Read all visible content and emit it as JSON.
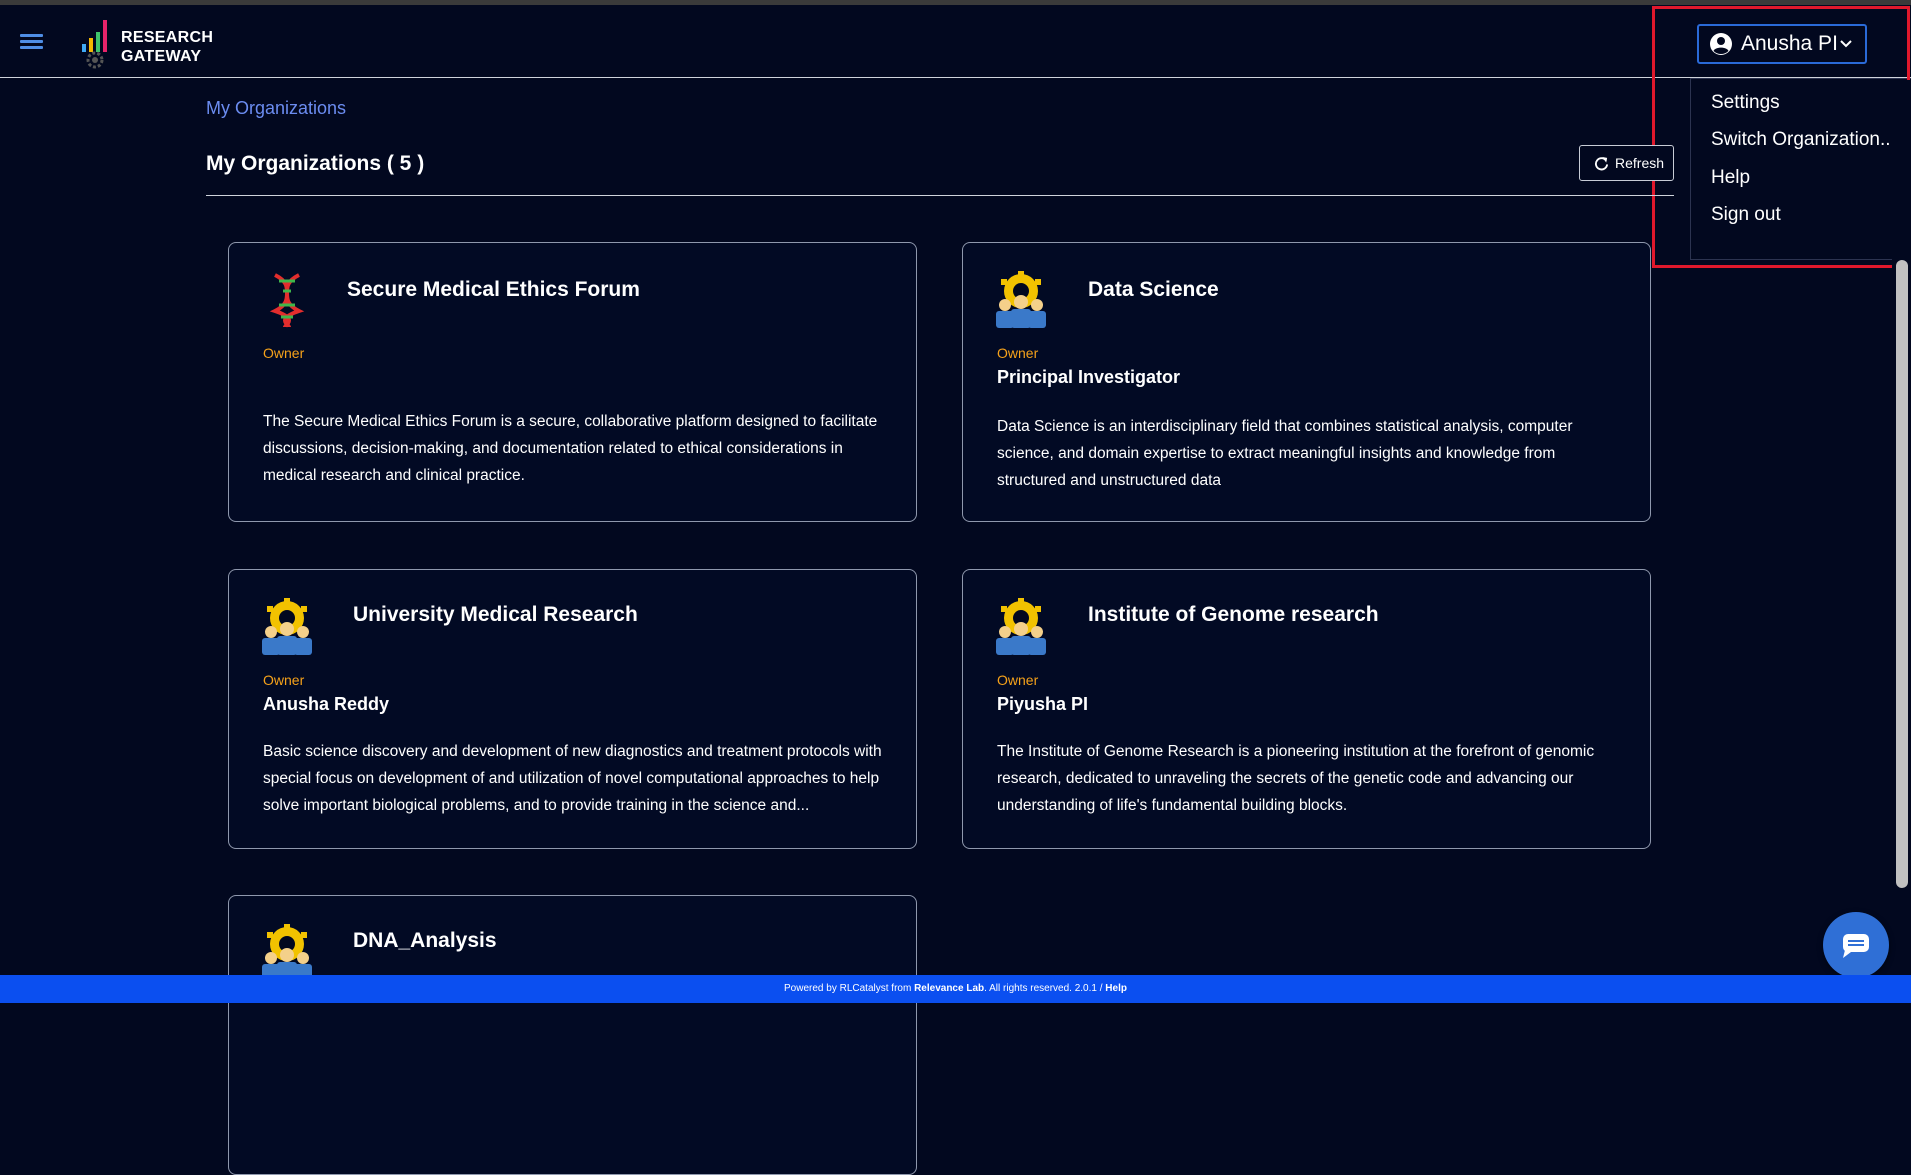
{
  "app": {
    "logo_line1": "RESEARCH",
    "logo_line2": "GATEWAY"
  },
  "user_menu": {
    "username": "Anusha PI",
    "items": [
      "Settings",
      "Switch Organization...",
      "Help",
      "Sign out"
    ]
  },
  "breadcrumb": "My Organizations",
  "page": {
    "title": "My Organizations ( 5 )",
    "refresh_label": "Refresh"
  },
  "organizations": [
    {
      "name": "Secure Medical Ethics Forum",
      "role": "Owner",
      "person": "",
      "icon": "dna-icon",
      "description": "The Secure Medical Ethics Forum is a secure, collaborative platform designed to facilitate discussions, decision-making, and documentation related to ethical considerations in medical research and clinical practice."
    },
    {
      "name": "Data Science",
      "role": "Owner",
      "person": "Principal Investigator",
      "icon": "team-gear-icon",
      "description": "Data Science is an interdisciplinary field that combines statistical analysis, computer science, and domain expertise to extract meaningful insights and knowledge from structured and unstructured data"
    },
    {
      "name": "University Medical Research",
      "role": "Owner",
      "person": "Anusha Reddy",
      "icon": "team-gear-icon",
      "description": "Basic science discovery and development of new diagnostics and treatment protocols with special focus on development of and utilization of novel computational approaches to help solve important biological problems, and to provide training in the science and..."
    },
    {
      "name": "Institute of Genome research",
      "role": "Owner",
      "person": "Piyusha PI",
      "icon": "team-gear-icon",
      "description": "The Institute of Genome Research is a pioneering institution at the forefront of genomic research, dedicated to unraveling the secrets of the genetic code and advancing our understanding of life's fundamental building blocks."
    },
    {
      "name": "DNA_Analysis",
      "role": "",
      "person": "",
      "icon": "team-gear-icon",
      "description": ""
    }
  ],
  "footer": {
    "prefix": "Powered by RLCatalyst from",
    "company": "Relevance Lab",
    "suffix": ". All rights reserved. 2.0.1 /",
    "help": "Help"
  },
  "colors": {
    "background": "#02081f",
    "accent": "#2a6ad8",
    "role": "#f6a21a",
    "footer": "#0b4ff0",
    "highlight": "#e0182c"
  }
}
